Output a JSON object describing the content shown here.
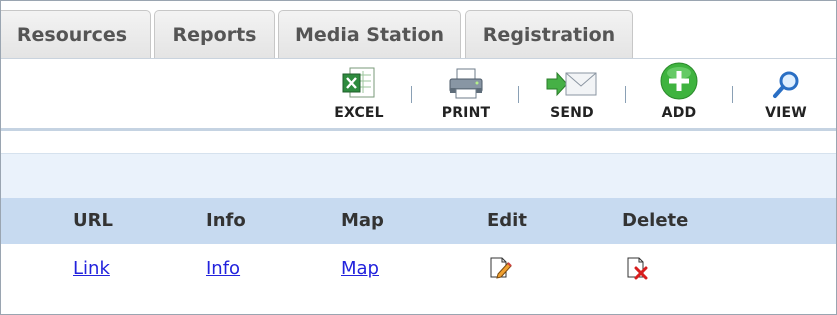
{
  "tabs": [
    {
      "label": "Resources"
    },
    {
      "label": "Reports"
    },
    {
      "label": "Media Station"
    },
    {
      "label": "Registration"
    }
  ],
  "toolbar": {
    "separator": "|",
    "excel_label": "EXCEL",
    "print_label": "PRINT",
    "send_label": "SEND",
    "add_label": "ADD",
    "view_label": "VIEW"
  },
  "grid": {
    "headers": {
      "url": "URL",
      "info": "Info",
      "map": "Map",
      "edit": "Edit",
      "delete": "Delete"
    },
    "rows": [
      {
        "url": "Link",
        "info": "Info",
        "map": "Map",
        "edit_icon": "edit-icon",
        "delete_icon": "delete-icon"
      }
    ]
  },
  "colors": {
    "header_bg": "#c7daf0",
    "title_bg": "#eaf2fb",
    "link": "#2222dd",
    "add_green": "#3fb33f"
  }
}
